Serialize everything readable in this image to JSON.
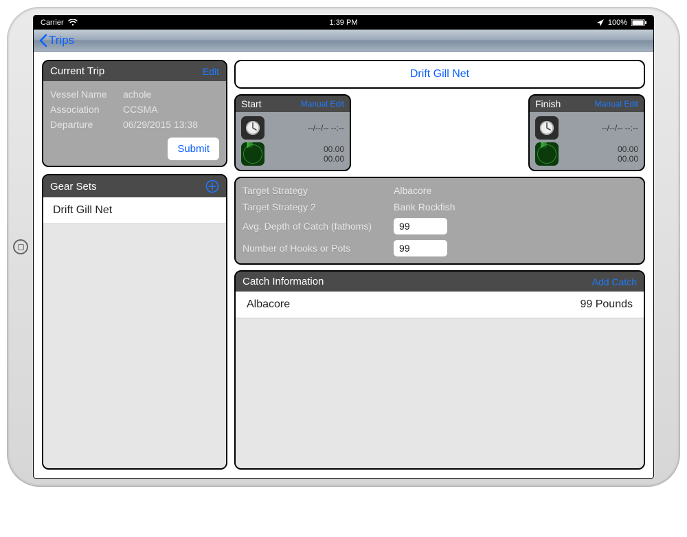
{
  "status_bar": {
    "carrier": "Carrier",
    "time": "1:39 PM",
    "battery": "100%"
  },
  "nav": {
    "back_label": "Trips"
  },
  "current_trip": {
    "title": "Current Trip",
    "edit_label": "Edit",
    "rows": {
      "vessel_label": "Vessel Name",
      "vessel_value": "achole",
      "assoc_label": "Association",
      "assoc_value": "CCSMA",
      "depart_label": "Departure",
      "depart_value": "06/29/2015 13:38"
    },
    "submit_label": "Submit"
  },
  "gear_sets": {
    "title": "Gear Sets",
    "items": [
      {
        "label": "Drift Gill Net"
      }
    ]
  },
  "gear_type_button": "Drift Gill Net",
  "start_panel": {
    "title": "Start",
    "manual_edit": "Manual Edit",
    "datetime": "--/--/-- --:--",
    "lat": "00.00",
    "lon": "00.00"
  },
  "finish_panel": {
    "title": "Finish",
    "manual_edit": "Manual Edit",
    "datetime": "--/--/-- --:--",
    "lat": "00.00",
    "lon": "00.00"
  },
  "strategy": {
    "target_label": "Target Strategy",
    "target_value": "Albacore",
    "target2_label": "Target Strategy 2",
    "target2_value": "Bank Rockfish",
    "depth_label": "Avg. Depth of Catch (fathoms)",
    "depth_value": "99",
    "hooks_label": "Number of Hooks or Pots",
    "hooks_value": "99"
  },
  "catch_info": {
    "title": "Catch Information",
    "add_label": "Add Catch",
    "rows": [
      {
        "species": "Albacore",
        "amount": "99 Pounds"
      }
    ]
  }
}
